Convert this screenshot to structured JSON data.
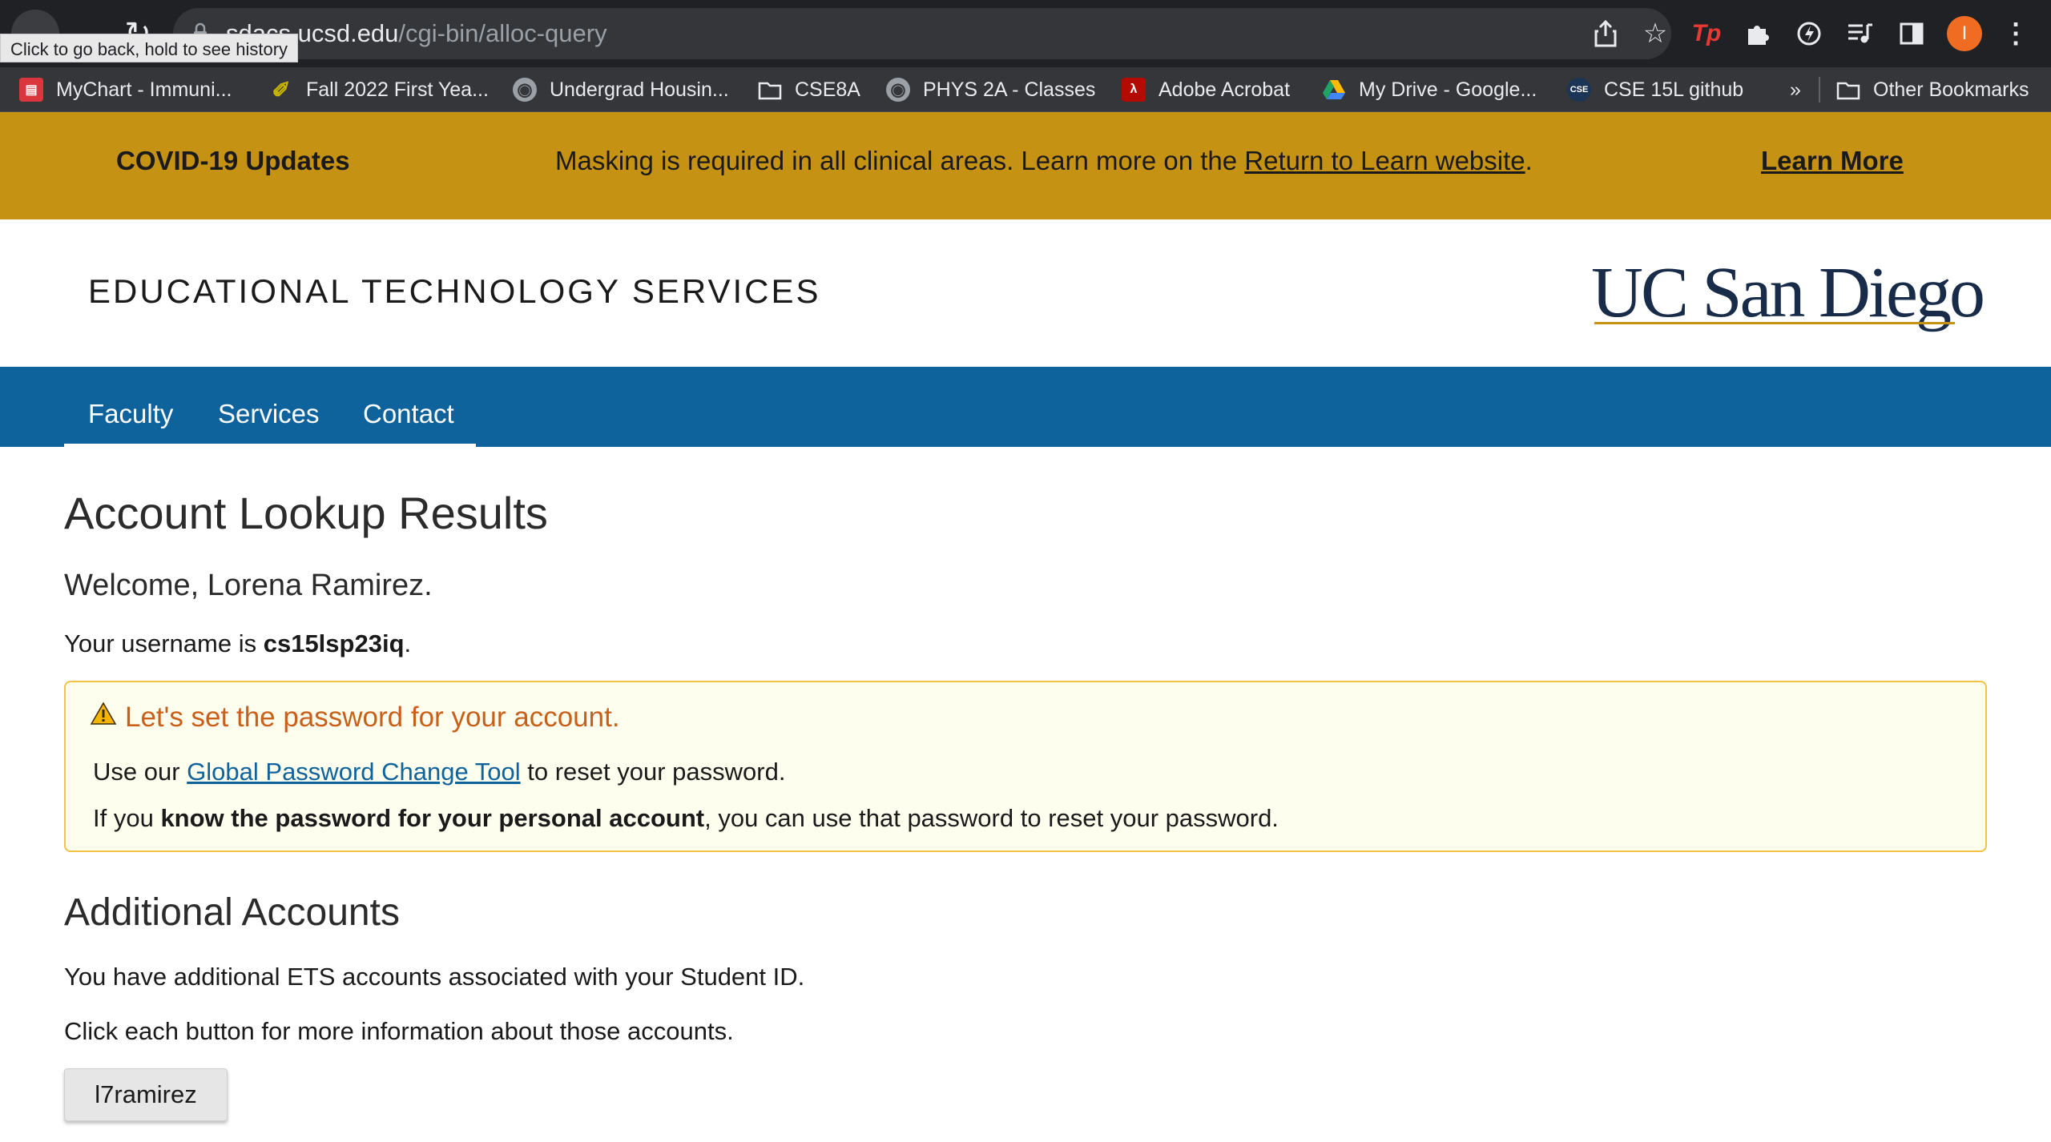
{
  "browser": {
    "tooltip": "Click to go back, hold to see history",
    "url_host": "sdacs.ucsd.edu",
    "url_path": "/cgi-bin/alloc-query",
    "avatar_letter": "I",
    "bookmarks": [
      {
        "label": "MyChart - Immuni...",
        "icon": "mychart-icon",
        "color": "#d9363e"
      },
      {
        "label": "Fall 2022 First Yea...",
        "icon": "pencil-icon",
        "color": "#c9b400"
      },
      {
        "label": "Undergrad Housin...",
        "icon": "globe-icon",
        "color": "#9aa0a6"
      },
      {
        "label": "CSE8A",
        "icon": "folder-icon",
        "color": "#e8eaed"
      },
      {
        "label": "PHYS 2A - Classes",
        "icon": "globe-icon",
        "color": "#9aa0a6"
      },
      {
        "label": "Adobe Acrobat",
        "icon": "acrobat-icon",
        "color": "#b30b00"
      },
      {
        "label": "My Drive - Google...",
        "icon": "google-drive-icon",
        "color": "#1fa463"
      },
      {
        "label": "CSE 15L github",
        "icon": "cse-icon",
        "color": "#1c3557"
      }
    ],
    "more_bookmarks": "»",
    "other_bookmarks": "Other Bookmarks"
  },
  "covid": {
    "title": "COVID-19 Updates",
    "message_prefix": "Masking is required in all clinical areas. Learn more on the ",
    "message_link": "Return to Learn website",
    "message_suffix": ".",
    "learn_more": "Learn More"
  },
  "header": {
    "dept_title": "EDUCATIONAL TECHNOLOGY SERVICES",
    "logo_text": "UC San Diego"
  },
  "nav": {
    "items": [
      "Faculty",
      "Services",
      "Contact"
    ]
  },
  "main": {
    "title": "Account Lookup Results",
    "welcome": "Welcome, Lorena Ramirez.",
    "username_prefix": "Your username is ",
    "username": "cs15lsp23iq",
    "username_suffix": ".",
    "alert": {
      "title": "Let's set the password for your account.",
      "line1_prefix": "Use our ",
      "line1_link": "Global Password Change Tool",
      "line1_suffix": " to reset your password.",
      "line2_prefix": "If you ",
      "line2_bold": "know the password for your personal account",
      "line2_suffix": ", you can use that password to reset your password."
    },
    "additional_title": "Additional Accounts",
    "additional_line1": "You have additional ETS accounts associated with your Student ID.",
    "additional_line2": "Click each button for more information about those accounts.",
    "account_button": "l7ramirez"
  },
  "colors": {
    "covid_bar": "#c69214",
    "nav_bar": "#0f639d",
    "alert_bg": "#fefeee",
    "alert_border": "#f3c246",
    "alert_title": "#c8601a",
    "logo": "#182b49"
  }
}
